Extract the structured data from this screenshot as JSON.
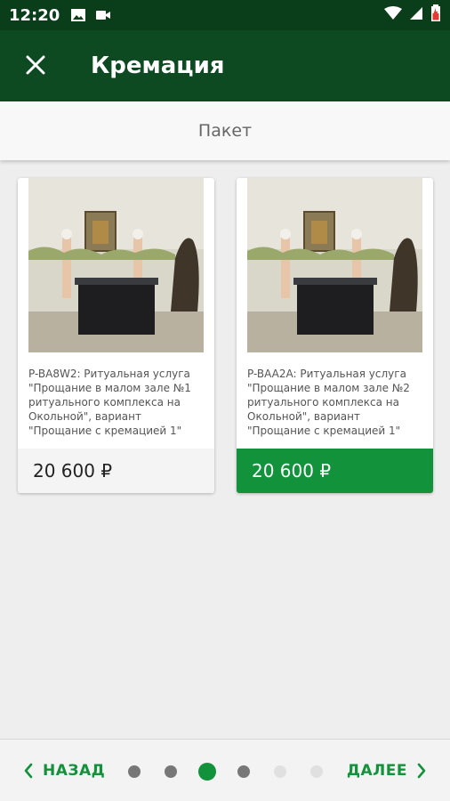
{
  "status_bar": {
    "time": "12:20"
  },
  "toolbar": {
    "title": "Кремация",
    "close_icon": "close-icon"
  },
  "section": {
    "title": "Пакет"
  },
  "cards": [
    {
      "description": "P-BA8W2: Ритуальная услуга \"Прощание в малом зале №1 ритуального комплекса на Окольной\", вариант \"Прощание с кремацией 1\"",
      "price": "20 600 ₽",
      "selected": false
    },
    {
      "description": "P-BAA2A: Ритуальная услуга \"Прощание в малом зале №2 ритуального комплекса на Окольной\", вариант \"Прощание с кремацией 1\"",
      "price": "20 600 ₽",
      "selected": true
    }
  ],
  "navigation": {
    "back_label": "НАЗАД",
    "next_label": "ДАЛЕЕ",
    "page_count": 6,
    "current_page": 3
  },
  "colors": {
    "primary_dark": "#0d4a22",
    "accent": "#11923b"
  }
}
